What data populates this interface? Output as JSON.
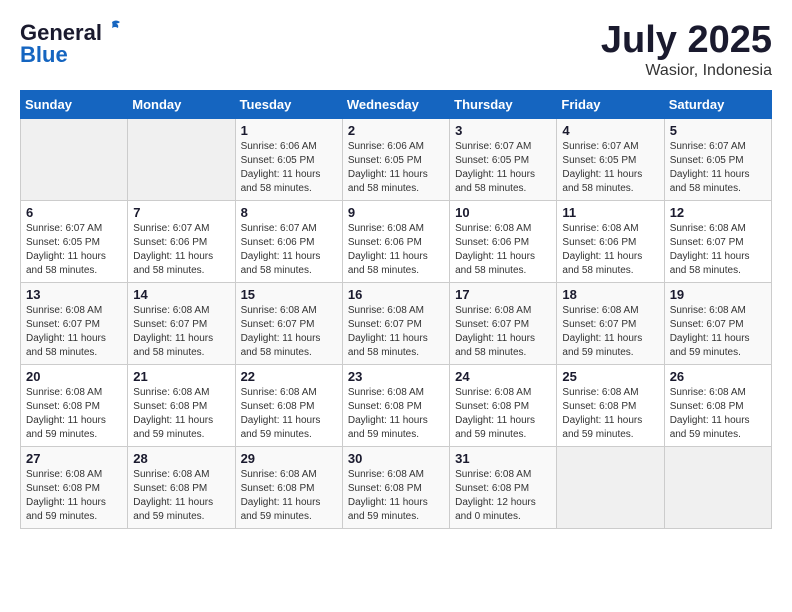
{
  "header": {
    "logo_general": "General",
    "logo_blue": "Blue",
    "month_title": "July 2025",
    "location": "Wasior, Indonesia"
  },
  "days_of_week": [
    "Sunday",
    "Monday",
    "Tuesday",
    "Wednesday",
    "Thursday",
    "Friday",
    "Saturday"
  ],
  "weeks": [
    [
      {
        "day": "",
        "sunrise": "",
        "sunset": "",
        "daylight": ""
      },
      {
        "day": "",
        "sunrise": "",
        "sunset": "",
        "daylight": ""
      },
      {
        "day": "1",
        "sunrise": "Sunrise: 6:06 AM",
        "sunset": "Sunset: 6:05 PM",
        "daylight": "Daylight: 11 hours and 58 minutes."
      },
      {
        "day": "2",
        "sunrise": "Sunrise: 6:06 AM",
        "sunset": "Sunset: 6:05 PM",
        "daylight": "Daylight: 11 hours and 58 minutes."
      },
      {
        "day": "3",
        "sunrise": "Sunrise: 6:07 AM",
        "sunset": "Sunset: 6:05 PM",
        "daylight": "Daylight: 11 hours and 58 minutes."
      },
      {
        "day": "4",
        "sunrise": "Sunrise: 6:07 AM",
        "sunset": "Sunset: 6:05 PM",
        "daylight": "Daylight: 11 hours and 58 minutes."
      },
      {
        "day": "5",
        "sunrise": "Sunrise: 6:07 AM",
        "sunset": "Sunset: 6:05 PM",
        "daylight": "Daylight: 11 hours and 58 minutes."
      }
    ],
    [
      {
        "day": "6",
        "sunrise": "Sunrise: 6:07 AM",
        "sunset": "Sunset: 6:05 PM",
        "daylight": "Daylight: 11 hours and 58 minutes."
      },
      {
        "day": "7",
        "sunrise": "Sunrise: 6:07 AM",
        "sunset": "Sunset: 6:06 PM",
        "daylight": "Daylight: 11 hours and 58 minutes."
      },
      {
        "day": "8",
        "sunrise": "Sunrise: 6:07 AM",
        "sunset": "Sunset: 6:06 PM",
        "daylight": "Daylight: 11 hours and 58 minutes."
      },
      {
        "day": "9",
        "sunrise": "Sunrise: 6:08 AM",
        "sunset": "Sunset: 6:06 PM",
        "daylight": "Daylight: 11 hours and 58 minutes."
      },
      {
        "day": "10",
        "sunrise": "Sunrise: 6:08 AM",
        "sunset": "Sunset: 6:06 PM",
        "daylight": "Daylight: 11 hours and 58 minutes."
      },
      {
        "day": "11",
        "sunrise": "Sunrise: 6:08 AM",
        "sunset": "Sunset: 6:06 PM",
        "daylight": "Daylight: 11 hours and 58 minutes."
      },
      {
        "day": "12",
        "sunrise": "Sunrise: 6:08 AM",
        "sunset": "Sunset: 6:07 PM",
        "daylight": "Daylight: 11 hours and 58 minutes."
      }
    ],
    [
      {
        "day": "13",
        "sunrise": "Sunrise: 6:08 AM",
        "sunset": "Sunset: 6:07 PM",
        "daylight": "Daylight: 11 hours and 58 minutes."
      },
      {
        "day": "14",
        "sunrise": "Sunrise: 6:08 AM",
        "sunset": "Sunset: 6:07 PM",
        "daylight": "Daylight: 11 hours and 58 minutes."
      },
      {
        "day": "15",
        "sunrise": "Sunrise: 6:08 AM",
        "sunset": "Sunset: 6:07 PM",
        "daylight": "Daylight: 11 hours and 58 minutes."
      },
      {
        "day": "16",
        "sunrise": "Sunrise: 6:08 AM",
        "sunset": "Sunset: 6:07 PM",
        "daylight": "Daylight: 11 hours and 58 minutes."
      },
      {
        "day": "17",
        "sunrise": "Sunrise: 6:08 AM",
        "sunset": "Sunset: 6:07 PM",
        "daylight": "Daylight: 11 hours and 58 minutes."
      },
      {
        "day": "18",
        "sunrise": "Sunrise: 6:08 AM",
        "sunset": "Sunset: 6:07 PM",
        "daylight": "Daylight: 11 hours and 59 minutes."
      },
      {
        "day": "19",
        "sunrise": "Sunrise: 6:08 AM",
        "sunset": "Sunset: 6:07 PM",
        "daylight": "Daylight: 11 hours and 59 minutes."
      }
    ],
    [
      {
        "day": "20",
        "sunrise": "Sunrise: 6:08 AM",
        "sunset": "Sunset: 6:08 PM",
        "daylight": "Daylight: 11 hours and 59 minutes."
      },
      {
        "day": "21",
        "sunrise": "Sunrise: 6:08 AM",
        "sunset": "Sunset: 6:08 PM",
        "daylight": "Daylight: 11 hours and 59 minutes."
      },
      {
        "day": "22",
        "sunrise": "Sunrise: 6:08 AM",
        "sunset": "Sunset: 6:08 PM",
        "daylight": "Daylight: 11 hours and 59 minutes."
      },
      {
        "day": "23",
        "sunrise": "Sunrise: 6:08 AM",
        "sunset": "Sunset: 6:08 PM",
        "daylight": "Daylight: 11 hours and 59 minutes."
      },
      {
        "day": "24",
        "sunrise": "Sunrise: 6:08 AM",
        "sunset": "Sunset: 6:08 PM",
        "daylight": "Daylight: 11 hours and 59 minutes."
      },
      {
        "day": "25",
        "sunrise": "Sunrise: 6:08 AM",
        "sunset": "Sunset: 6:08 PM",
        "daylight": "Daylight: 11 hours and 59 minutes."
      },
      {
        "day": "26",
        "sunrise": "Sunrise: 6:08 AM",
        "sunset": "Sunset: 6:08 PM",
        "daylight": "Daylight: 11 hours and 59 minutes."
      }
    ],
    [
      {
        "day": "27",
        "sunrise": "Sunrise: 6:08 AM",
        "sunset": "Sunset: 6:08 PM",
        "daylight": "Daylight: 11 hours and 59 minutes."
      },
      {
        "day": "28",
        "sunrise": "Sunrise: 6:08 AM",
        "sunset": "Sunset: 6:08 PM",
        "daylight": "Daylight: 11 hours and 59 minutes."
      },
      {
        "day": "29",
        "sunrise": "Sunrise: 6:08 AM",
        "sunset": "Sunset: 6:08 PM",
        "daylight": "Daylight: 11 hours and 59 minutes."
      },
      {
        "day": "30",
        "sunrise": "Sunrise: 6:08 AM",
        "sunset": "Sunset: 6:08 PM",
        "daylight": "Daylight: 11 hours and 59 minutes."
      },
      {
        "day": "31",
        "sunrise": "Sunrise: 6:08 AM",
        "sunset": "Sunset: 6:08 PM",
        "daylight": "Daylight: 12 hours and 0 minutes."
      },
      {
        "day": "",
        "sunrise": "",
        "sunset": "",
        "daylight": ""
      },
      {
        "day": "",
        "sunrise": "",
        "sunset": "",
        "daylight": ""
      }
    ]
  ]
}
